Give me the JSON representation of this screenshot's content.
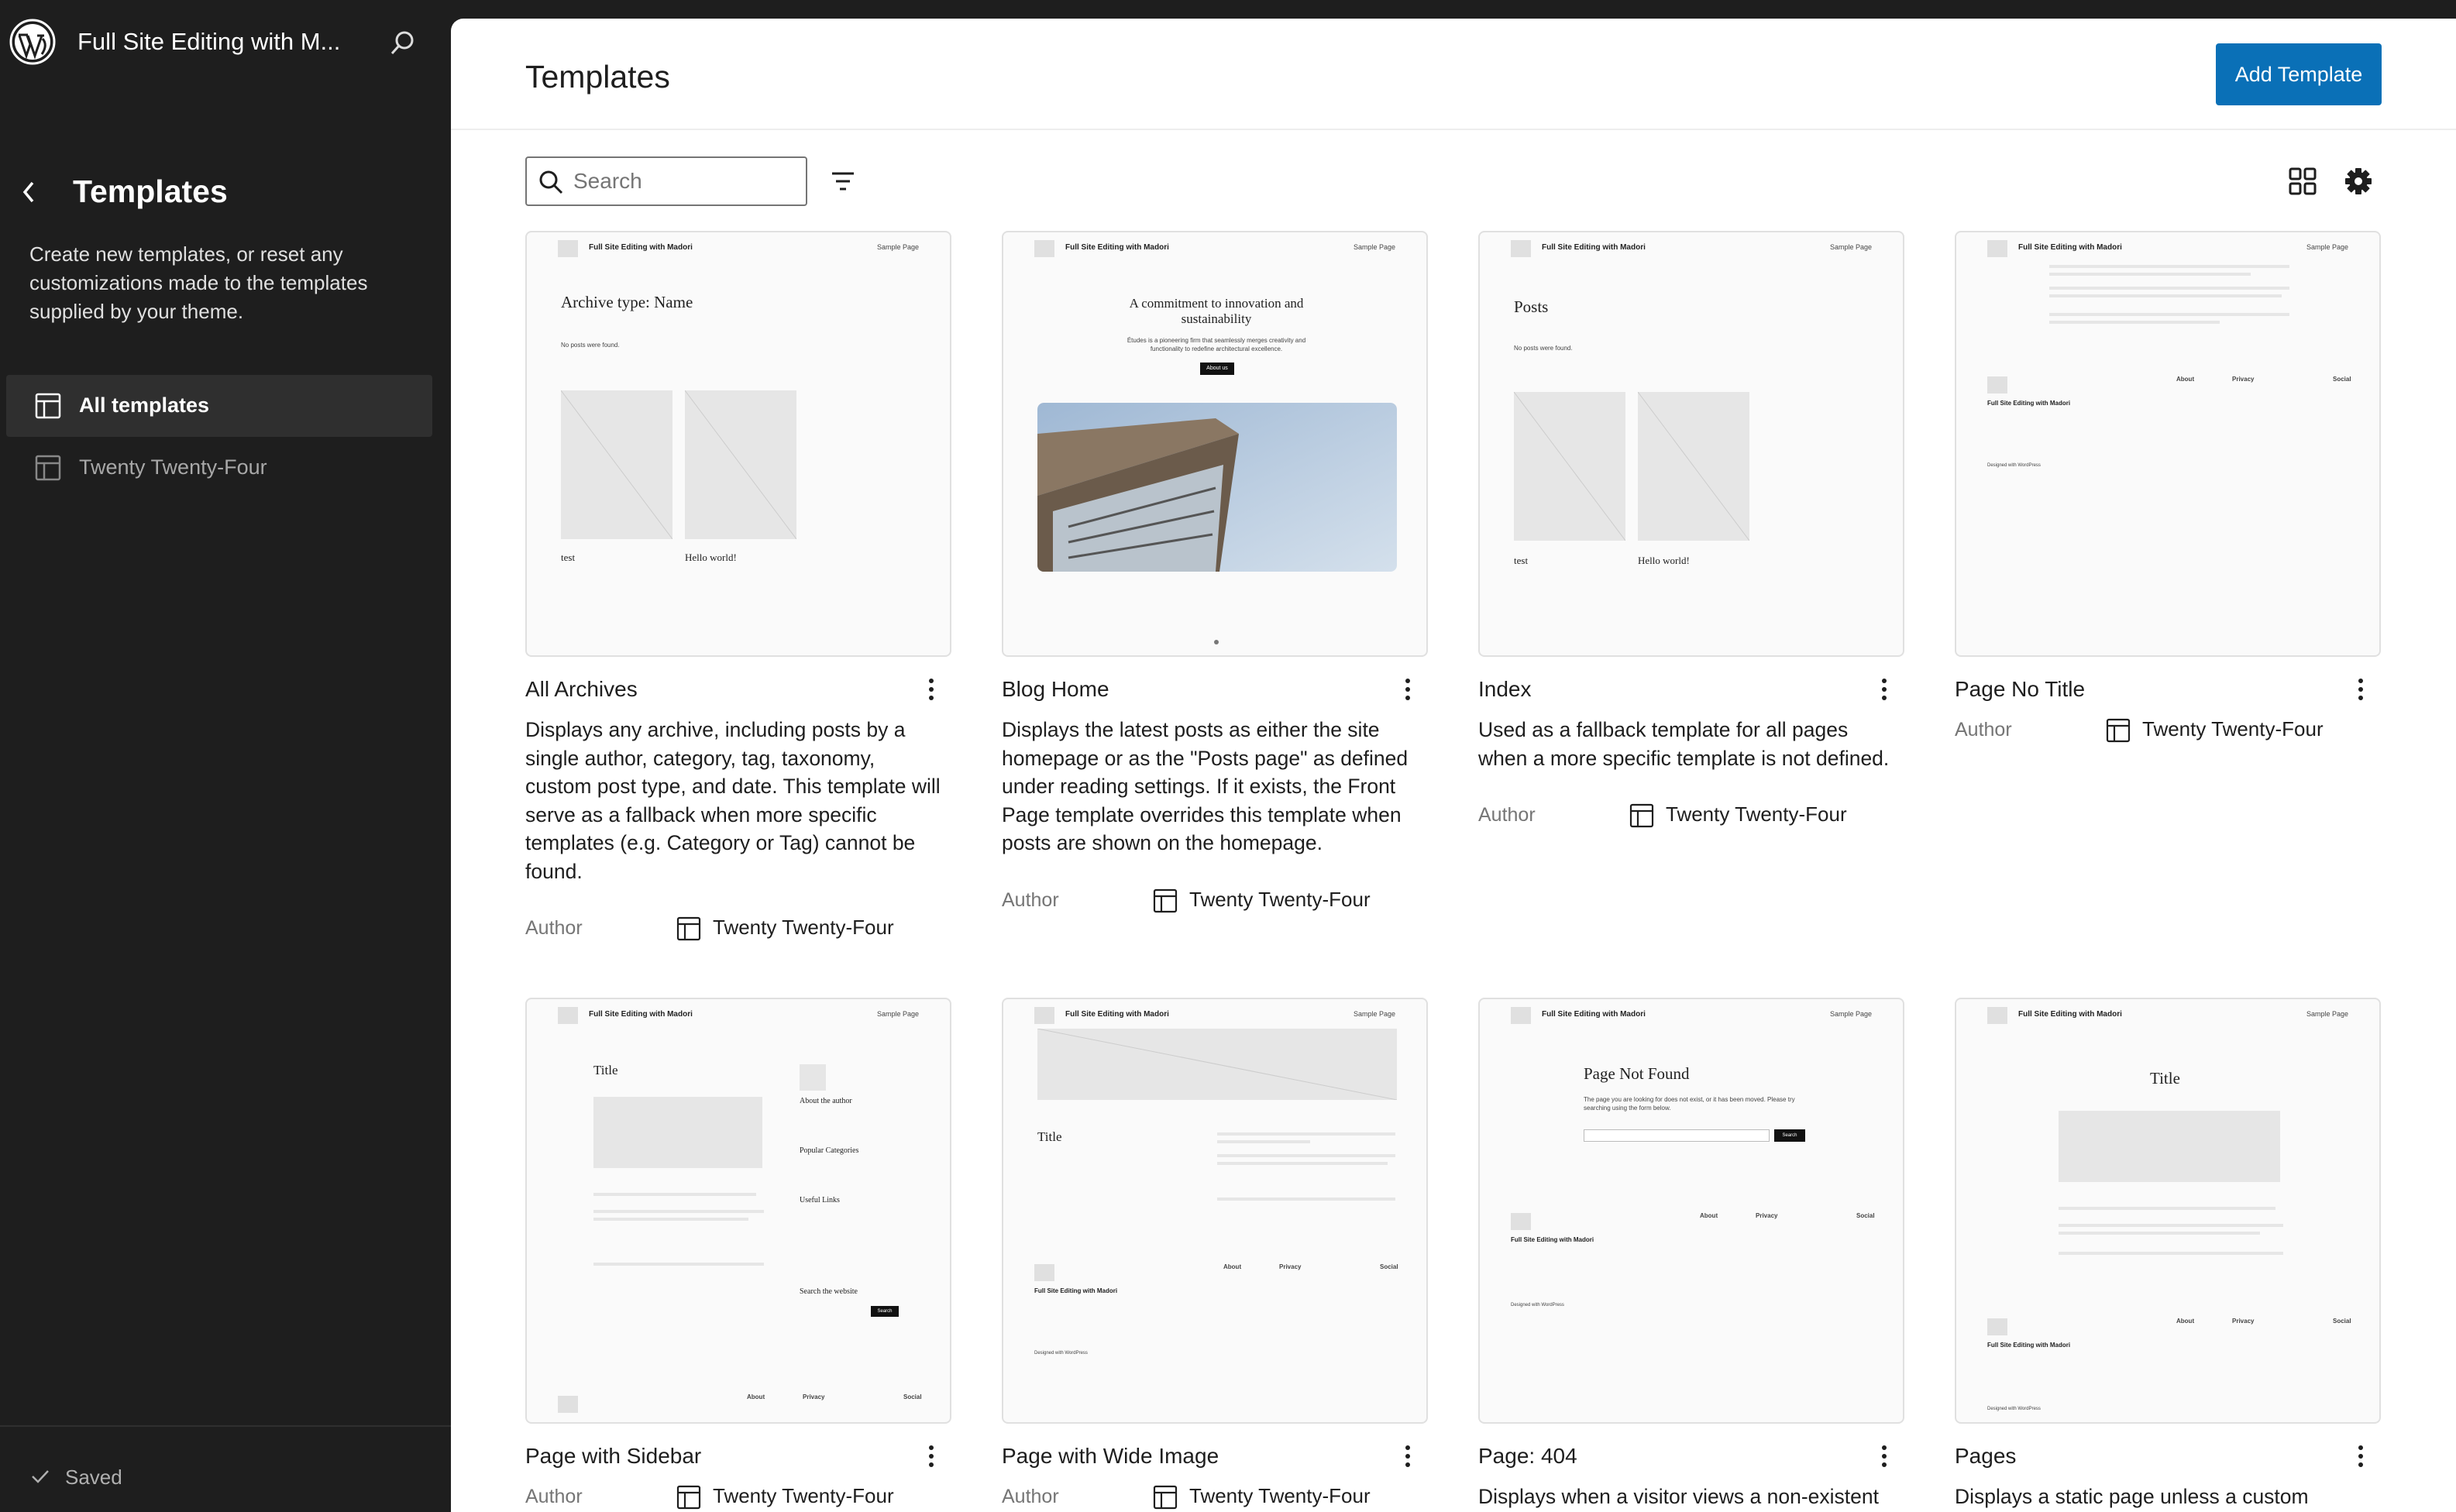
{
  "site": {
    "title": "Full Site Editing with M...",
    "title_full": "Full Site Editing with Madori"
  },
  "sidebar": {
    "title": "Templates",
    "description": "Create new templates, or reset any customizations made to the templates supplied by your theme.",
    "items": [
      {
        "label": "All templates",
        "active": true
      },
      {
        "label": "Twenty Twenty-Four",
        "active": false
      }
    ],
    "status": "Saved"
  },
  "main": {
    "title": "Templates",
    "add_button": "Add Template",
    "search_placeholder": "Search"
  },
  "author_label": "Author",
  "cards": [
    {
      "title": "All Archives",
      "desc": "Displays any archive, including posts by a single author, category, tag, taxonomy, custom post type, and date. This template will serve as a fallback when more specific templates (e.g. Category or Tag) cannot be found.",
      "theme": "Twenty Twenty-Four"
    },
    {
      "title": "Blog Home",
      "desc": "Displays the latest posts as either the site homepage or as the \"Posts page\" as defined under reading settings. If it exists, the Front Page template overrides this template when posts are shown on the homepage.",
      "theme": "Twenty Twenty-Four"
    },
    {
      "title": "Index",
      "desc": "Used as a fallback template for all pages when a more specific template is not defined.",
      "theme": "Twenty Twenty-Four"
    },
    {
      "title": "Page No Title",
      "desc": "",
      "theme": "Twenty Twenty-Four"
    },
    {
      "title": "Page with Sidebar",
      "desc": "",
      "theme": "Twenty Twenty-Four"
    },
    {
      "title": "Page with Wide Image",
      "desc": "",
      "theme": "Twenty Twenty-Four"
    },
    {
      "title": "Page: 404",
      "desc": "Displays when a visitor views a non-existent",
      "theme": ""
    },
    {
      "title": "Pages",
      "desc": "Displays a static page unless a custom",
      "theme": ""
    }
  ],
  "thumbs": {
    "nav": "Sample Page",
    "archive_heading": "Archive type: Name",
    "no_posts": "No posts were found.",
    "post1": "test",
    "post2": "Hello world!",
    "blog_heading": "A commitment to innovation and sustainability",
    "blog_text": "Études is a pioneering firm that seamlessly merges creativity and functionality to redefine architectural excellence.",
    "blog_button": "About us",
    "posts_heading": "Posts",
    "title_word": "Title",
    "about_author": "About the author",
    "popular": "Popular Categories",
    "useful": "Useful Links",
    "search_site": "Search the website",
    "notfound_heading": "Page Not Found",
    "notfound_text": "The page you are looking for does not exist, or it has been moved. Please try searching using the form below.",
    "search_btn": "Search",
    "footer_cols": [
      "About",
      "Privacy",
      "Social"
    ],
    "designed": "Designed with WordPress"
  }
}
